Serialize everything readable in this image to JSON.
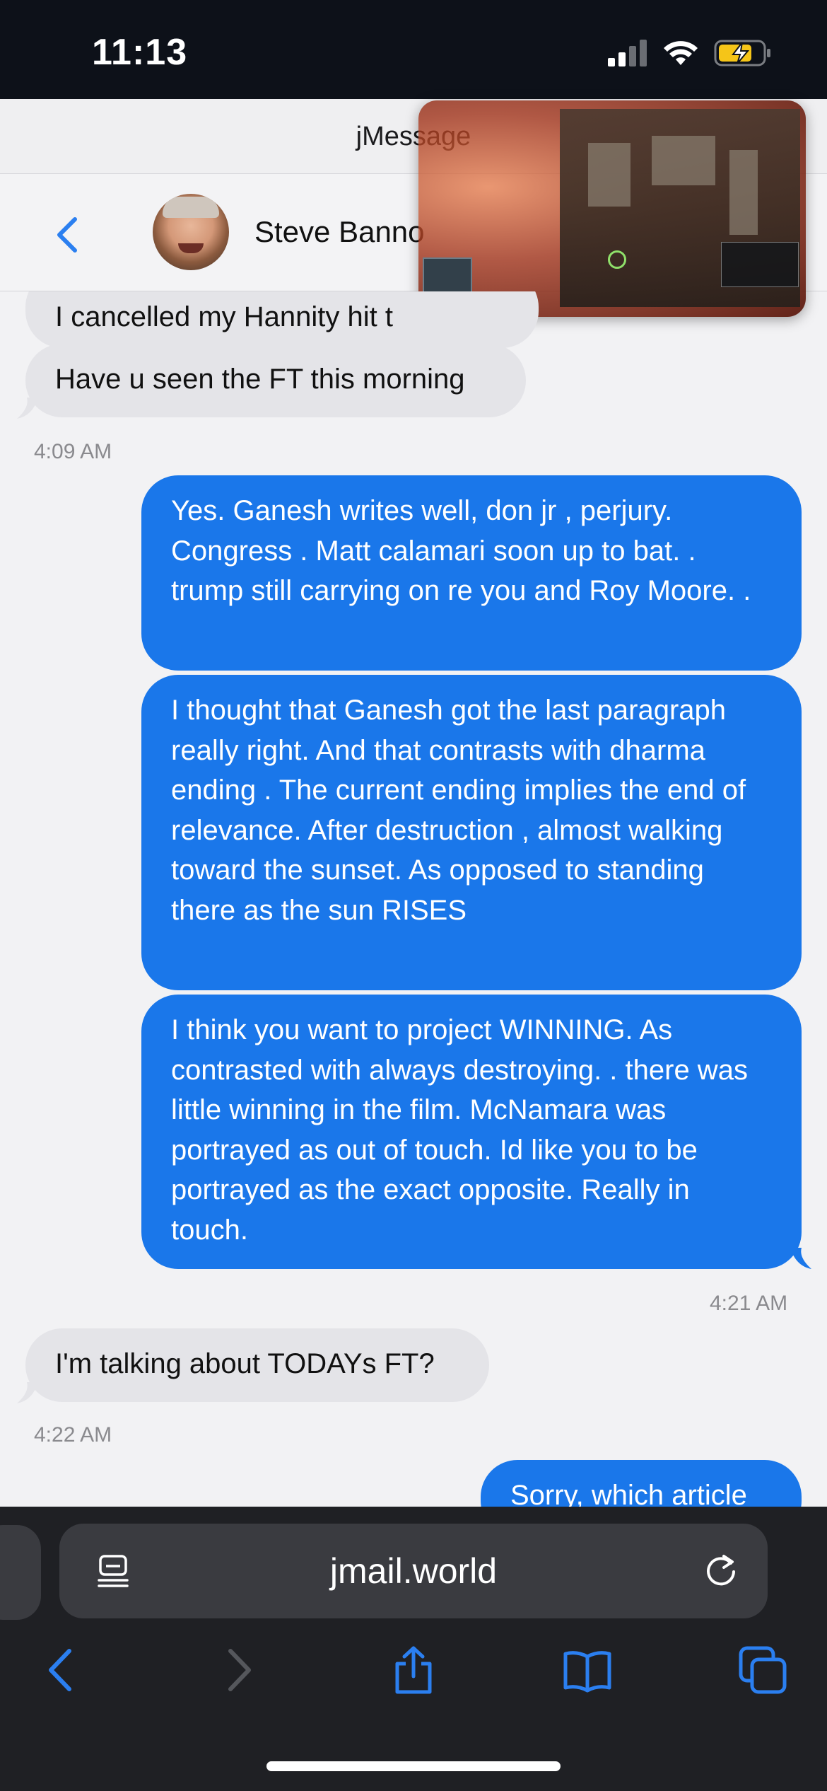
{
  "status_bar": {
    "time": "11:13"
  },
  "app": {
    "title": "jMessage"
  },
  "contact": {
    "name": "Steve Bannon"
  },
  "messages": [
    {
      "direction": "incoming",
      "text": "I cancelled my Hannity hit t"
    },
    {
      "direction": "incoming",
      "text": "Have u seen the FT this morning"
    },
    {
      "type": "timestamp",
      "text": "4:09 AM"
    },
    {
      "direction": "outgoing",
      "text": "Yes. Ganesh writes well, don jr , perjury. Congress . Matt calamari soon up to bat. . trump still carrying on re you and Roy Moore. ."
    },
    {
      "direction": "outgoing",
      "text": "I thought that Ganesh got the last paragraph really right. And that contrasts with dharma ending . The current ending implies the end of relevance. After destruction , almost walking toward the sunset. As opposed to standing there as the sun RISES"
    },
    {
      "direction": "outgoing",
      "text": "I think you want to project WINNING. As contrasted with always destroying. . there was little winning in the film. McNamara was portrayed as out of touch. Id like you to be portrayed as the exact opposite. Really in touch."
    },
    {
      "type": "timestamp",
      "text": "4:21 AM"
    },
    {
      "direction": "incoming",
      "text": "I'm talking about TODAYs FT?"
    },
    {
      "type": "timestamp",
      "text": "4:22 AM"
    },
    {
      "direction": "outgoing",
      "text": "Sorry, which article"
    }
  ],
  "browser": {
    "url": "jmail.world",
    "icons": {
      "reader": "reader-mode-icon",
      "reload": "reload-icon",
      "back": "back-arrow-icon",
      "forward": "forward-arrow-icon",
      "share": "share-icon",
      "bookmarks": "bookmarks-icon",
      "tabs": "tabs-icon"
    }
  },
  "colors": {
    "outgoing_bubble": "#1a77ea",
    "incoming_bubble": "#e4e4e8",
    "accent": "#2b7ff0",
    "status_bar": "#0d1119",
    "browser_bar": "#1f2024"
  }
}
